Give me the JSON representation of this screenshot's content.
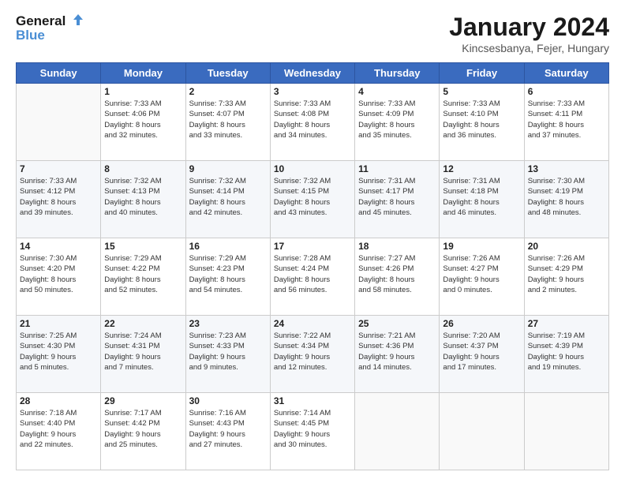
{
  "logo": {
    "line1": "General",
    "line2": "Blue"
  },
  "title": "January 2024",
  "location": "Kincsesbanya, Fejer, Hungary",
  "days_header": [
    "Sunday",
    "Monday",
    "Tuesday",
    "Wednesday",
    "Thursday",
    "Friday",
    "Saturday"
  ],
  "weeks": [
    [
      {
        "num": "",
        "info": ""
      },
      {
        "num": "1",
        "info": "Sunrise: 7:33 AM\nSunset: 4:06 PM\nDaylight: 8 hours\nand 32 minutes."
      },
      {
        "num": "2",
        "info": "Sunrise: 7:33 AM\nSunset: 4:07 PM\nDaylight: 8 hours\nand 33 minutes."
      },
      {
        "num": "3",
        "info": "Sunrise: 7:33 AM\nSunset: 4:08 PM\nDaylight: 8 hours\nand 34 minutes."
      },
      {
        "num": "4",
        "info": "Sunrise: 7:33 AM\nSunset: 4:09 PM\nDaylight: 8 hours\nand 35 minutes."
      },
      {
        "num": "5",
        "info": "Sunrise: 7:33 AM\nSunset: 4:10 PM\nDaylight: 8 hours\nand 36 minutes."
      },
      {
        "num": "6",
        "info": "Sunrise: 7:33 AM\nSunset: 4:11 PM\nDaylight: 8 hours\nand 37 minutes."
      }
    ],
    [
      {
        "num": "7",
        "info": "Sunrise: 7:33 AM\nSunset: 4:12 PM\nDaylight: 8 hours\nand 39 minutes."
      },
      {
        "num": "8",
        "info": "Sunrise: 7:32 AM\nSunset: 4:13 PM\nDaylight: 8 hours\nand 40 minutes."
      },
      {
        "num": "9",
        "info": "Sunrise: 7:32 AM\nSunset: 4:14 PM\nDaylight: 8 hours\nand 42 minutes."
      },
      {
        "num": "10",
        "info": "Sunrise: 7:32 AM\nSunset: 4:15 PM\nDaylight: 8 hours\nand 43 minutes."
      },
      {
        "num": "11",
        "info": "Sunrise: 7:31 AM\nSunset: 4:17 PM\nDaylight: 8 hours\nand 45 minutes."
      },
      {
        "num": "12",
        "info": "Sunrise: 7:31 AM\nSunset: 4:18 PM\nDaylight: 8 hours\nand 46 minutes."
      },
      {
        "num": "13",
        "info": "Sunrise: 7:30 AM\nSunset: 4:19 PM\nDaylight: 8 hours\nand 48 minutes."
      }
    ],
    [
      {
        "num": "14",
        "info": "Sunrise: 7:30 AM\nSunset: 4:20 PM\nDaylight: 8 hours\nand 50 minutes."
      },
      {
        "num": "15",
        "info": "Sunrise: 7:29 AM\nSunset: 4:22 PM\nDaylight: 8 hours\nand 52 minutes."
      },
      {
        "num": "16",
        "info": "Sunrise: 7:29 AM\nSunset: 4:23 PM\nDaylight: 8 hours\nand 54 minutes."
      },
      {
        "num": "17",
        "info": "Sunrise: 7:28 AM\nSunset: 4:24 PM\nDaylight: 8 hours\nand 56 minutes."
      },
      {
        "num": "18",
        "info": "Sunrise: 7:27 AM\nSunset: 4:26 PM\nDaylight: 8 hours\nand 58 minutes."
      },
      {
        "num": "19",
        "info": "Sunrise: 7:26 AM\nSunset: 4:27 PM\nDaylight: 9 hours\nand 0 minutes."
      },
      {
        "num": "20",
        "info": "Sunrise: 7:26 AM\nSunset: 4:29 PM\nDaylight: 9 hours\nand 2 minutes."
      }
    ],
    [
      {
        "num": "21",
        "info": "Sunrise: 7:25 AM\nSunset: 4:30 PM\nDaylight: 9 hours\nand 5 minutes."
      },
      {
        "num": "22",
        "info": "Sunrise: 7:24 AM\nSunset: 4:31 PM\nDaylight: 9 hours\nand 7 minutes."
      },
      {
        "num": "23",
        "info": "Sunrise: 7:23 AM\nSunset: 4:33 PM\nDaylight: 9 hours\nand 9 minutes."
      },
      {
        "num": "24",
        "info": "Sunrise: 7:22 AM\nSunset: 4:34 PM\nDaylight: 9 hours\nand 12 minutes."
      },
      {
        "num": "25",
        "info": "Sunrise: 7:21 AM\nSunset: 4:36 PM\nDaylight: 9 hours\nand 14 minutes."
      },
      {
        "num": "26",
        "info": "Sunrise: 7:20 AM\nSunset: 4:37 PM\nDaylight: 9 hours\nand 17 minutes."
      },
      {
        "num": "27",
        "info": "Sunrise: 7:19 AM\nSunset: 4:39 PM\nDaylight: 9 hours\nand 19 minutes."
      }
    ],
    [
      {
        "num": "28",
        "info": "Sunrise: 7:18 AM\nSunset: 4:40 PM\nDaylight: 9 hours\nand 22 minutes."
      },
      {
        "num": "29",
        "info": "Sunrise: 7:17 AM\nSunset: 4:42 PM\nDaylight: 9 hours\nand 25 minutes."
      },
      {
        "num": "30",
        "info": "Sunrise: 7:16 AM\nSunset: 4:43 PM\nDaylight: 9 hours\nand 27 minutes."
      },
      {
        "num": "31",
        "info": "Sunrise: 7:14 AM\nSunset: 4:45 PM\nDaylight: 9 hours\nand 30 minutes."
      },
      {
        "num": "",
        "info": ""
      },
      {
        "num": "",
        "info": ""
      },
      {
        "num": "",
        "info": ""
      }
    ]
  ]
}
